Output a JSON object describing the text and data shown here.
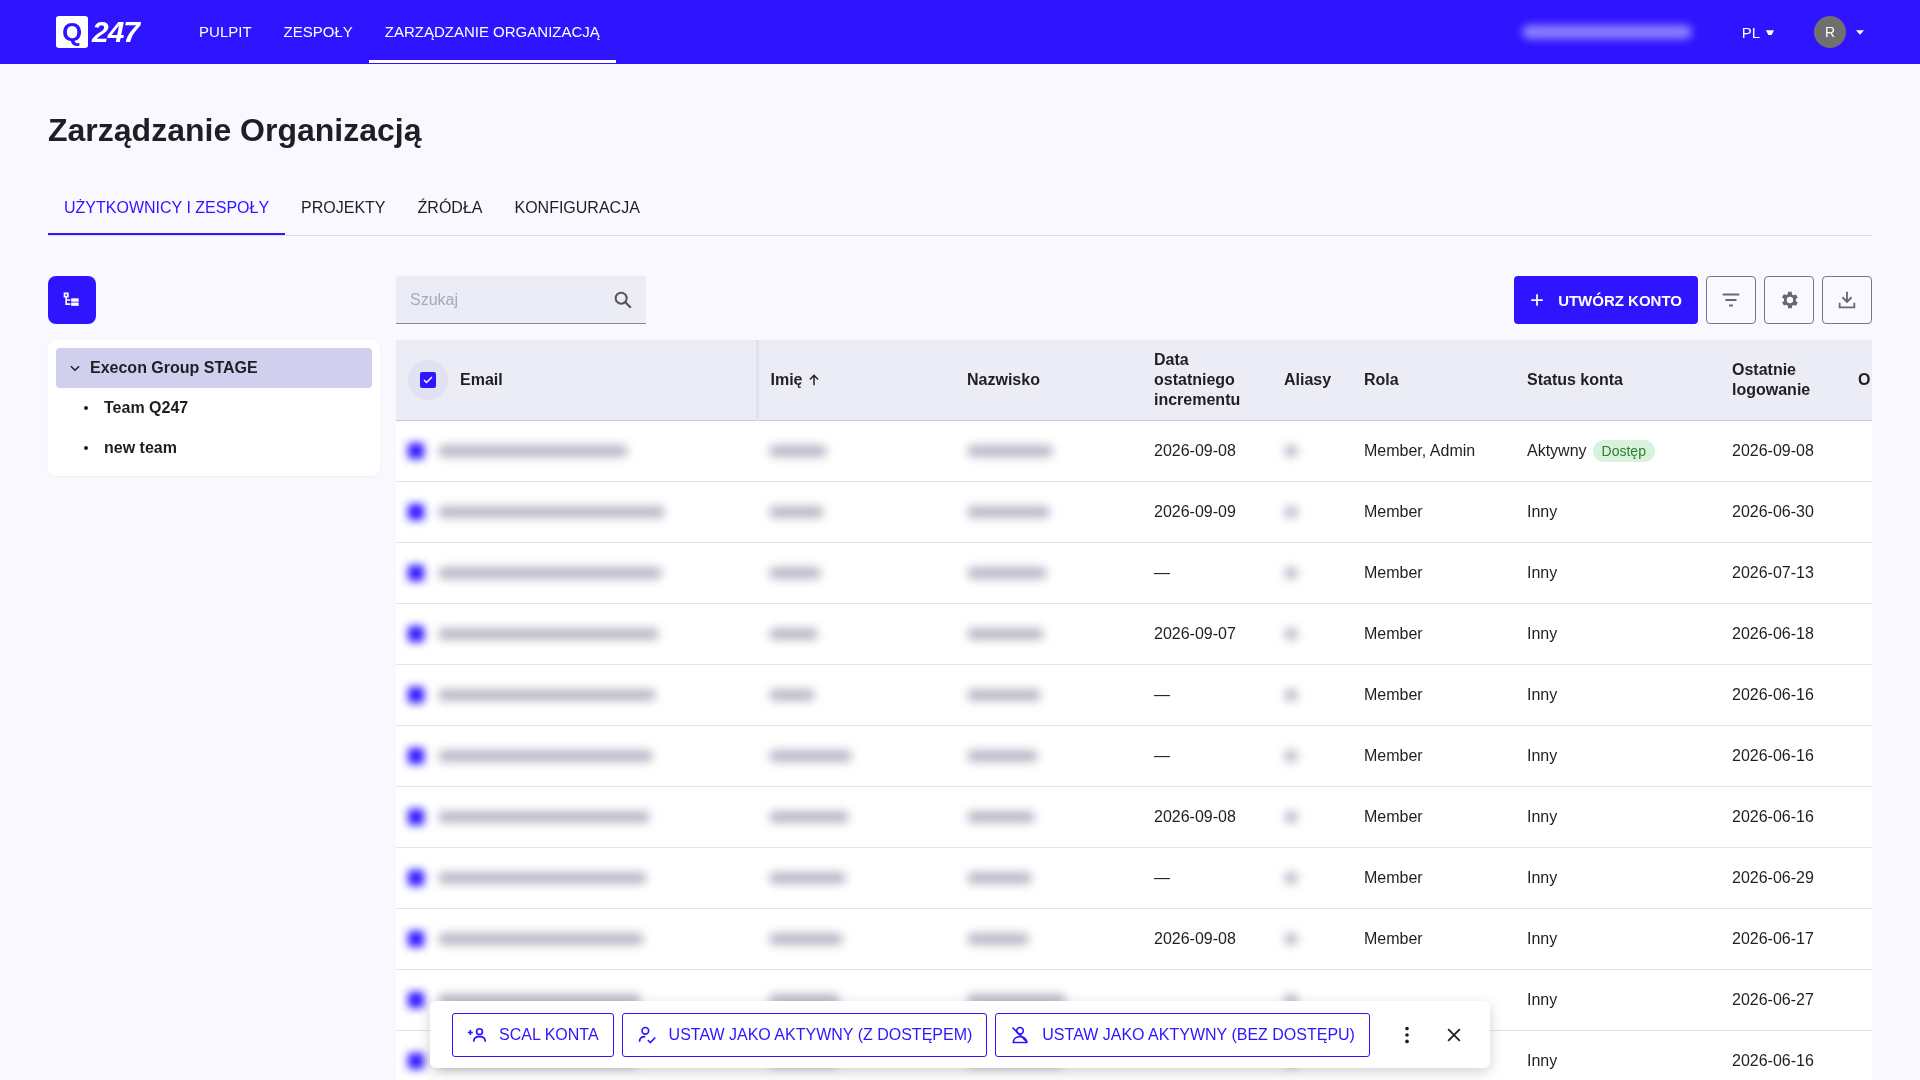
{
  "nav": {
    "logo_mark": "Q",
    "logo_text": "247",
    "items": [
      {
        "label": "PULPIT",
        "selected": false
      },
      {
        "label": "ZESPOŁY",
        "selected": false
      },
      {
        "label": "ZARZĄDZANIE ORGANIZACJĄ",
        "selected": true
      }
    ],
    "language": "PL",
    "avatar": "R"
  },
  "title": "Zarządzanie Organizacją",
  "tabs": [
    {
      "label": "UŻYTKOWNICY I ZESPOŁY",
      "selected": true
    },
    {
      "label": "PROJEKTY",
      "selected": false
    },
    {
      "label": "ŹRÓDŁA",
      "selected": false
    },
    {
      "label": "KONFIGURACJA",
      "selected": false
    }
  ],
  "tree": [
    {
      "label": "Execon Group STAGE",
      "expanded": true,
      "selected": true,
      "children": [
        {
          "label": "Team Q247",
          "selected": false
        },
        {
          "label": "new team",
          "selected": false
        }
      ]
    }
  ],
  "search": {
    "placeholder": "Szukaj"
  },
  "create_button": "UTWÓRZ KONTO",
  "table": {
    "all_checked": true,
    "columns": [
      {
        "label": "Email",
        "kind": "blurred"
      },
      {
        "label": "Imię",
        "kind": "blurred",
        "sorted": true
      },
      {
        "label": "Nazwisko",
        "kind": "blurred"
      },
      {
        "label": "Data ostatniego incrementu",
        "kind": "text"
      },
      {
        "label": "Aliasy",
        "kind": "blurred"
      },
      {
        "label": "Rola",
        "kind": "text"
      },
      {
        "label": "Status konta",
        "kind": "status"
      },
      {
        "label": "Ostatnie logowanie",
        "kind": "text"
      },
      {
        "label": "O",
        "kind": "text"
      }
    ],
    "rows": [
      {
        "checked": true,
        "cells": {
          "3": "2026-09-08",
          "5": "Member, Admin",
          "6": "Aktywny",
          "7": "2026-09-08"
        },
        "badge": "Dostęp"
      },
      {
        "checked": true,
        "cells": {
          "3": "2026-09-09",
          "5": "Member",
          "6": "Inny",
          "7": "2026-06-30"
        }
      },
      {
        "checked": true,
        "cells": {
          "3": "—",
          "5": "Member",
          "6": "Inny",
          "7": "2026-07-13"
        }
      },
      {
        "checked": true,
        "cells": {
          "3": "2026-09-07",
          "5": "Member",
          "6": "Inny",
          "7": "2026-06-18"
        }
      },
      {
        "checked": true,
        "cells": {
          "3": "—",
          "5": "Member",
          "6": "Inny",
          "7": "2026-06-16"
        }
      },
      {
        "checked": true,
        "cells": {
          "3": "—",
          "5": "Member",
          "6": "Inny",
          "7": "2026-06-16"
        }
      },
      {
        "checked": true,
        "cells": {
          "3": "2026-09-08",
          "5": "Member",
          "6": "Inny",
          "7": "2026-06-16"
        }
      },
      {
        "checked": true,
        "cells": {
          "3": "—",
          "5": "Member",
          "6": "Inny",
          "7": "2026-06-29"
        }
      },
      {
        "checked": true,
        "cells": {
          "3": "2026-09-08",
          "5": "Member",
          "6": "Inny",
          "7": "2026-06-17"
        }
      },
      {
        "checked": true,
        "cells": {
          "6": "Inny",
          "7": "2026-06-27"
        }
      },
      {
        "checked": true,
        "cells": {
          "6": "Inny",
          "7": "2026-06-16"
        }
      }
    ]
  },
  "action_bar": {
    "buttons": [
      {
        "label": "SCAL KONTA",
        "kind": "merge"
      },
      {
        "label": "USTAW JAKO AKTYWNY (Z DOSTĘPEM)",
        "kind": "with-access"
      },
      {
        "label": "USTAW JAKO AKTYWNY (BEZ DOSTĘPU)",
        "kind": "without-access"
      }
    ]
  }
}
